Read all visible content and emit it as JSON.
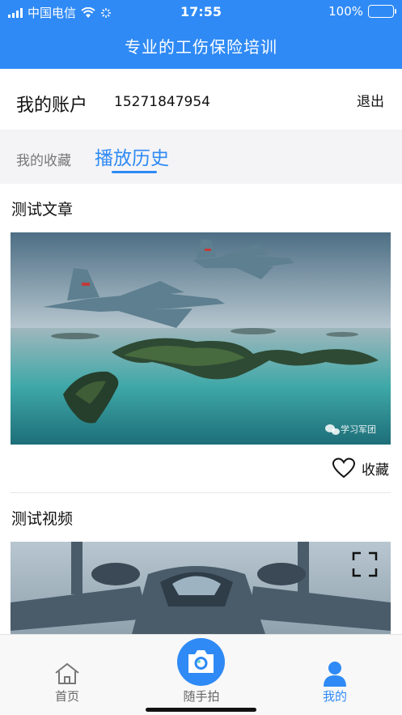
{
  "status_bar": {
    "carrier": "中国电信",
    "time": "17:55",
    "battery": "100%"
  },
  "header": {
    "title": "专业的工伤保险培训"
  },
  "account": {
    "label": "我的账户",
    "phone": "15271847954",
    "logout": "退出"
  },
  "tabs": {
    "favorites": "我的收藏",
    "history": "播放历史",
    "active": "history"
  },
  "items": [
    {
      "title": "测试文章",
      "watermark": "学习军团",
      "favorite_label": "收藏"
    },
    {
      "title": "测试视频"
    }
  ],
  "bottom_nav": {
    "home": "首页",
    "snapshot": "随手拍",
    "mine": "我的",
    "active": "mine"
  },
  "colors": {
    "brand": "#2f8af5",
    "active_tab": "#2f8af5",
    "inactive": "#666666"
  }
}
